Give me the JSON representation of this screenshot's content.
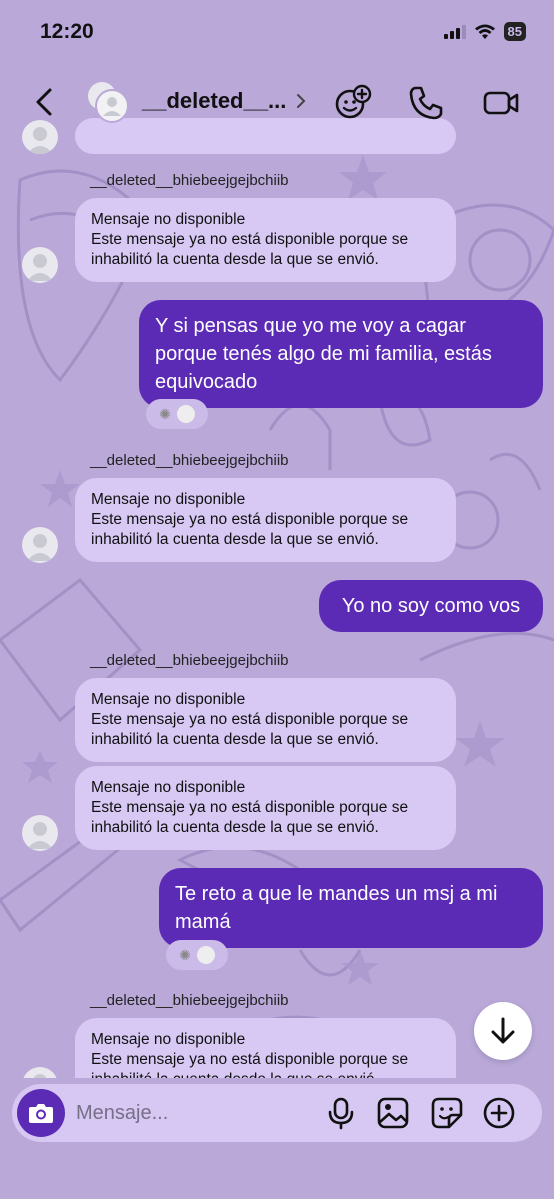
{
  "status": {
    "time": "12:20",
    "battery": "85"
  },
  "header": {
    "name": "__deleted__..."
  },
  "messages": {
    "sender_name": "__deleted__bhiebeejgejbchiib",
    "unavailable_title": "Mensaje no disponible",
    "unavailable_line1": "Este mensaje ya no está disponible porque se",
    "unavailable_line2": "inhabilitó la cuenta desde la que se envió.",
    "out1_line1": "Y si pensas que yo me voy a cagar",
    "out1_line2": "porque tenés algo de mi familia, estás",
    "out1_line3": "equivocado",
    "out2": "Yo no soy como vos",
    "out3_line1": "Te reto a que le mandes un msj a mi",
    "out3_line2": "mamá"
  },
  "composer": {
    "placeholder": "Mensaje..."
  },
  "colors": {
    "accent": "#5b2bb5",
    "background": "#b9a8d8",
    "incoming": "#d8c9f4"
  }
}
